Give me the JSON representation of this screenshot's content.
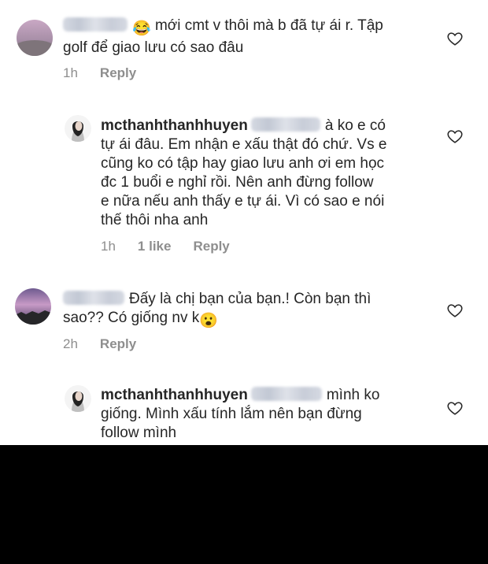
{
  "comments": [
    {
      "type": "comment",
      "username": "",
      "emoji": "😂",
      "text_line1": "mới cmt v thôi mà b đã tự ái r. Tập",
      "text_rest": "golf để giao lưu có sao đâu",
      "time": "1h",
      "likes": "",
      "reply": "Reply"
    },
    {
      "type": "reply",
      "username": "mcthanhthanhhuyen",
      "lines": [
        "à ko e có",
        "tự ái đâu. Em nhận e xấu thật đó chứ. Vs e",
        "cũng ko có tập hay giao lưu anh ơi em học",
        "đc 1 buổi e nghỉ rồi. Nên anh đừng follow",
        "e nữa nếu anh thấy e tự ái. Vì có sao e nói",
        "thế thôi nha anh"
      ],
      "time": "1h",
      "likes": "1 like",
      "reply": "Reply"
    },
    {
      "type": "comment",
      "username": "",
      "lines": [
        "Đấy là chị bạn của bạn.! Còn bạn thì",
        "sao?? Có giống nv k"
      ],
      "emoji": "😮",
      "time": "2h",
      "likes": "",
      "reply": "Reply"
    },
    {
      "type": "reply",
      "username": "mcthanhthanhhuyen",
      "lines": [
        "mình ko",
        "giống. Mình xấu tính lắm nên bạn đừng",
        "follow mình"
      ],
      "time": "",
      "likes": "",
      "reply": ""
    }
  ],
  "icons": {
    "like": "heart-outline-icon"
  },
  "colors": {
    "text": "#262626",
    "meta": "#8e8e8e",
    "blocked_region": "#000000"
  }
}
